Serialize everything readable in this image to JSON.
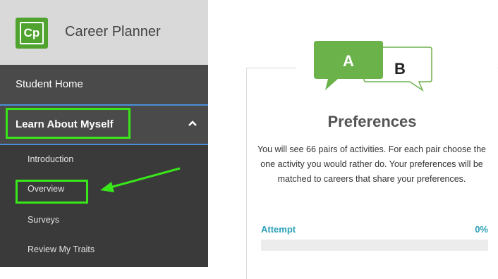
{
  "sidebar": {
    "logo_text": "Cp",
    "brand_name": "Career Planner",
    "home_label": "Student Home",
    "section_label": "Learn About Myself",
    "items": [
      {
        "label": "Introduction"
      },
      {
        "label": "Overview"
      },
      {
        "label": "Surveys"
      },
      {
        "label": "Review My Traits"
      }
    ]
  },
  "card": {
    "bubble_a": "A",
    "bubble_b": "B",
    "title": "Preferences",
    "description": "You will see 66 pairs of activities. For each pair choose the one activity you would rather do. Your preferences will be matched to careers that share your preferences.",
    "attempt_label": "Attempt",
    "progress_text": "0%",
    "progress_value": 0
  },
  "colors": {
    "brand_green": "#4fa32e",
    "highlight_green": "#39e61a",
    "accent_teal": "#2ba1b6",
    "sidebar_dark": "#3a3a3a"
  }
}
